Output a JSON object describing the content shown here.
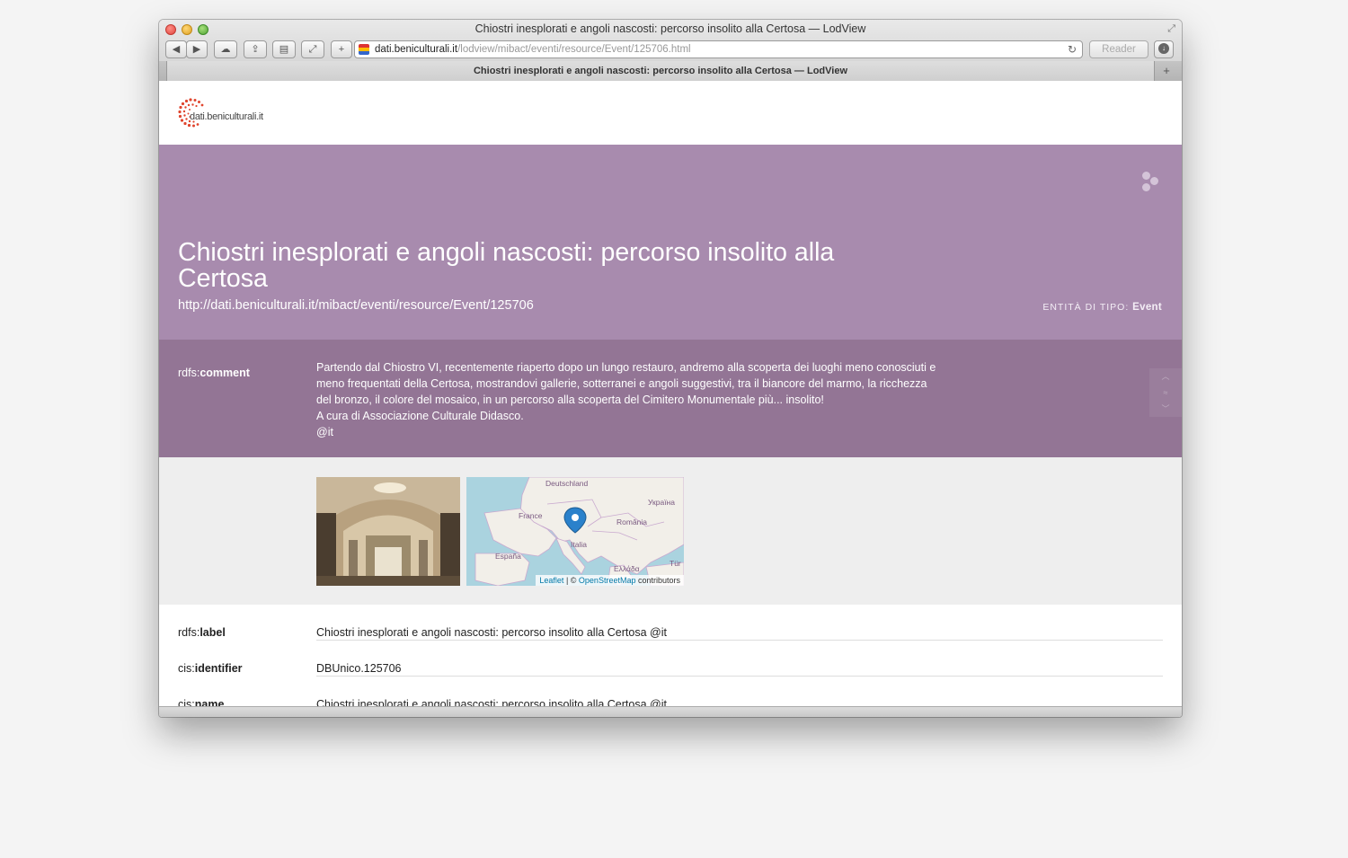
{
  "window": {
    "title": "Chiostri inesplorati e angoli nascosti: percorso insolito alla Certosa — LodView"
  },
  "toolbar": {
    "back_icon": "back-arrow-icon",
    "forward_icon": "forward-arrow-icon",
    "add_icon": "+",
    "address_domain": "dati.beniculturali.it",
    "address_path": "/lodview/mibact/eventi/resource/Event/125706.html",
    "reader_label": "Reader"
  },
  "tab": {
    "title": "Chiostri inesplorati e angoli nascosti: percorso insolito alla Certosa — LodView",
    "new_tab": "+"
  },
  "header": {
    "logo_text": "dati.beniculturali.it"
  },
  "hero": {
    "title": "Chiostri inesplorati e angoli nascosti: percorso insolito alla Certosa",
    "uri": "http://dati.beniculturali.it/mibact/eventi/resource/Event/125706",
    "type_prefix": "ENTITÀ DI TIPO:",
    "type_value": "Event",
    "bg_color": "#a88bae"
  },
  "comment": {
    "prefix": "rdfs:",
    "name": "comment",
    "lines": [
      "Partendo dal Chiostro VI, recentemente riaperto dopo un lungo restauro, andremo alla scoperta dei luoghi meno conosciuti e",
      "meno frequentati della Certosa, mostrandovi gallerie, sotterranei e angoli suggestivi, tra il biancore del marmo, la ricchezza",
      "del bronzo, il colore del mosaico, in un percorso alla scoperta del Cimitero Monumentale più... insolito!",
      "A cura di Associazione Culturale Didasco.",
      "@it"
    ],
    "bg_color": "#937595"
  },
  "map": {
    "labels": {
      "deutschland": "Deutschland",
      "ukraina": "Україна",
      "france": "France",
      "romania": "România",
      "italia": "Italia",
      "espana": "España",
      "ellada": "Ελλάδα",
      "tur": "Tür"
    },
    "attribution_leaflet": "Leaflet",
    "attribution_sep": " | © ",
    "attribution_osm": "OpenStreetMap",
    "attribution_tail": " contributors"
  },
  "properties": [
    {
      "prefix": "rdfs:",
      "name": "label",
      "value": "Chiostri inesplorati e angoli nascosti: percorso insolito alla Certosa  @it"
    },
    {
      "prefix": "cis:",
      "name": "identifier",
      "value": "DBUnico.125706"
    },
    {
      "prefix": "cis:",
      "name": "name",
      "value": "Chiostri inesplorati e angoli nascosti: percorso insolito alla Certosa  @it"
    }
  ]
}
